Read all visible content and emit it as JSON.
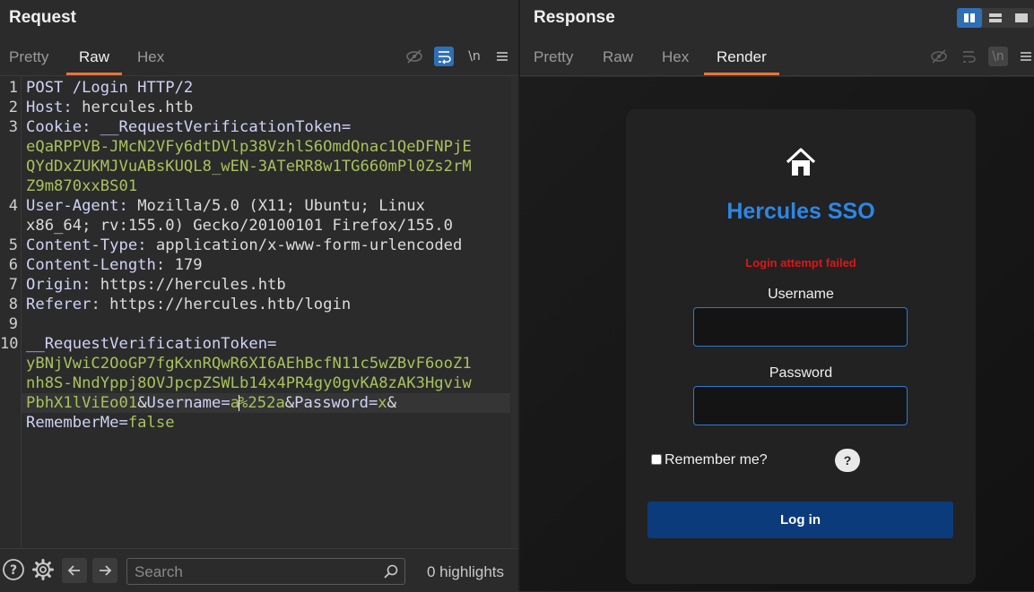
{
  "request": {
    "title": "Request",
    "tabs": [
      "Pretty",
      "Raw",
      "Hex"
    ],
    "newline_toggle": "\\n",
    "lines": {
      "l1": "POST /Login HTTP/2",
      "l2k": "Host",
      "l2v": " hercules.htb",
      "l3k": "Cookie",
      "l3v": "__RequestVerificationToken=",
      "l3t1": "eQaRPPVB-JMcN2VFy6dtDVlp38VzhlS6OmdQnac1QeDFNPjE",
      "l3t2": "QYdDxZUKMJVuABsKUQL8_wEN-3ATeRR8w1TG660mPl0Zs2rM",
      "l3t3": "Z9m870xxBS01",
      "l4k": "User-Agent",
      "l4v": " Mozilla/5.0 (X11; Ubuntu; Linux",
      "l4c": "x86_64; rv:155.0) Gecko/20100101 Firefox/155.0",
      "l5k": "Content-Type",
      "l5v": " application/x-www-form-urlencoded",
      "l6k": "Content-Length",
      "l6v": " 179",
      "l7k": "Origin",
      "l7v": " https://hercules.htb",
      "l8k": "Referer",
      "l8v": " https://hercules.htb/login",
      "l10k": "__RequestVerificationToken=",
      "l10t1": "yBNjVwiC2OoGP7fgKxnRQwR6XI6AEhBcfN11c5wZBvF6ooZ1",
      "l10t2": "nh8S-NndYppj8OVJpcpZSWLb14x4PR4gy0gvKA8zAK3Hgviw",
      "l10t3": "PbhX1lViEo01",
      "amp": "&",
      "user_key": "Username=",
      "user_v1": "a",
      "user_v2": "%252a",
      "pass_key": "Password=",
      "pass_v": "x",
      "rem_key": "RememberMe=",
      "rem_v": "false"
    },
    "line_numbers": [
      "1",
      "2",
      "3",
      "4",
      "5",
      "6",
      "7",
      "8",
      "9",
      "10"
    ]
  },
  "bottom": {
    "search_placeholder": "Search",
    "highlights": "0 highlights"
  },
  "response": {
    "title": "Response",
    "tabs": [
      "Pretty",
      "Raw",
      "Hex",
      "Render"
    ],
    "page": {
      "heading": "Hercules SSO",
      "error": "Login attempt failed",
      "username_label": "Username",
      "password_label": "Password",
      "remember_label": "Remember me?",
      "help": "?",
      "login_button": "Log in"
    }
  },
  "colors": {
    "accent_tab": "#e8743b",
    "toolbar_active": "#2f6fb6",
    "token_green": "#a9c25b",
    "header_key": "#cfd3f5",
    "sso_blue": "#2d86e6",
    "error_red": "#e01515",
    "login_button": "#0c3b7c"
  },
  "icons": [
    "hide-icon",
    "wrap-icon",
    "menu-icon",
    "help-circle-icon",
    "gear-icon",
    "arrow-left-icon",
    "arrow-right-icon",
    "search-icon",
    "home-icon",
    "layout-split-icon",
    "layout-rows-icon",
    "layout-single-icon"
  ]
}
